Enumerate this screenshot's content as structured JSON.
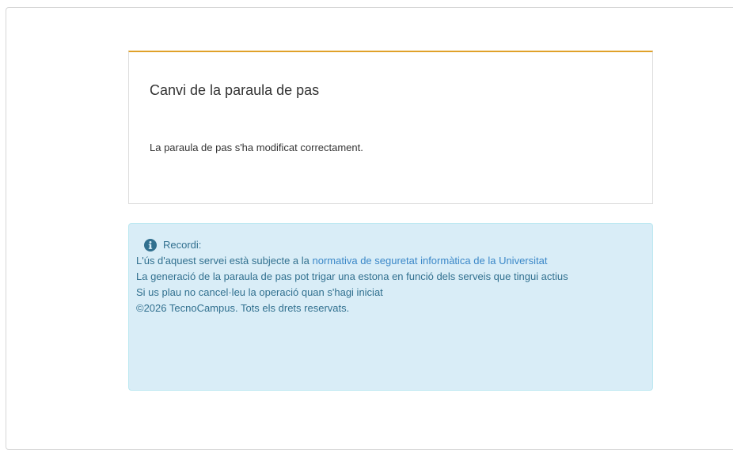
{
  "card": {
    "title": "Canvi de la paraula de pas",
    "message": "La paraula de pas s'ha modificat correctament."
  },
  "info": {
    "heading": "Recordi:",
    "line1_text": "L'ús d'aquest servei està subjecte a la",
    "line1_link": "normativa de seguretat informàtica de la Universitat",
    "line2": "La generació de la paraula de pas pot trigar una estona en funció dels serveis que tingui actius",
    "line3": "Si us plau no cancel·leu la operació quan s'hagi iniciat",
    "line4": "©2026 TecnoCampus. Tots els drets reservats."
  },
  "colors": {
    "card_accent": "#e0a129",
    "info_background": "#d9edf7",
    "info_text": "#31708f",
    "link": "#3a87c8"
  },
  "icons": {
    "info": "info-circle-icon"
  }
}
